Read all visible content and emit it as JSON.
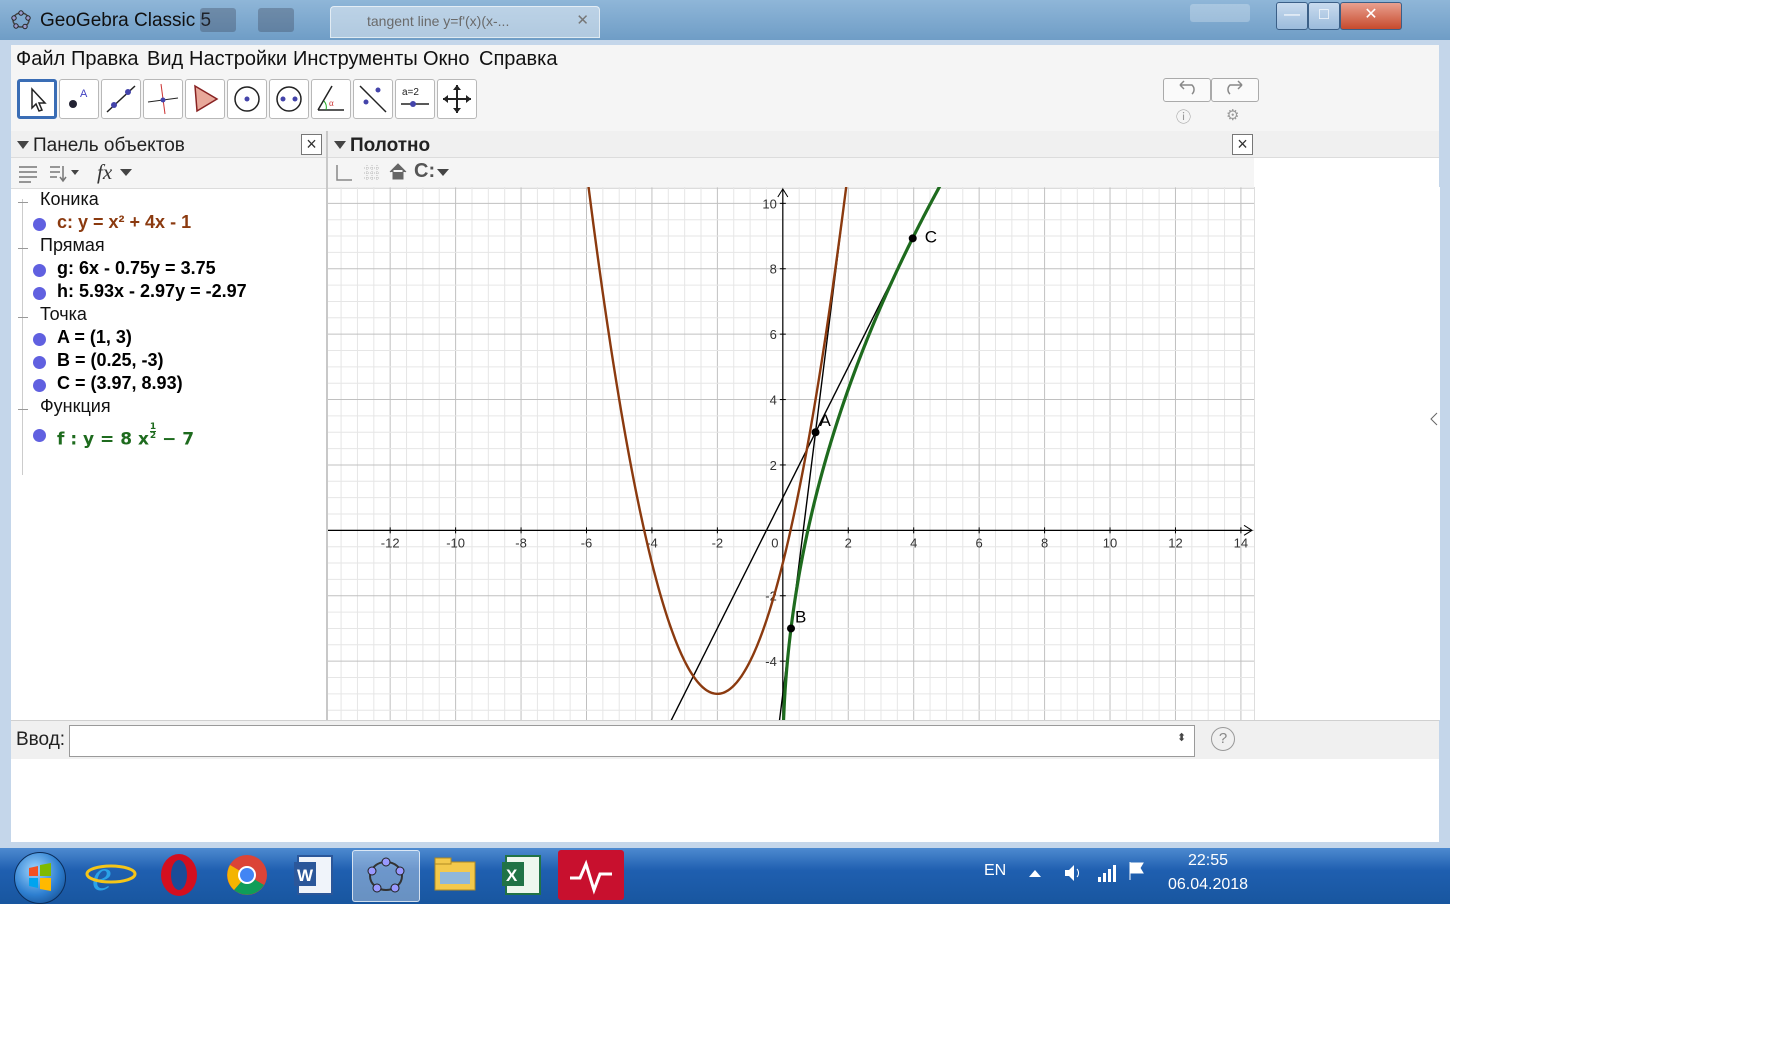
{
  "window": {
    "title": "GeoGebra Classic 5",
    "background_tab": "tangent line y=f'(x)(x-...",
    "buttons": {
      "minimize": "—",
      "maximize": "□",
      "close": "✕"
    }
  },
  "menu": [
    "Файл",
    "Правка",
    "Вид",
    "Настройки",
    "Инструменты",
    "Окно",
    "Справка"
  ],
  "toolbar": {
    "tools": [
      "move-tool",
      "point-tool",
      "line-tool",
      "perpendicular-tool",
      "polygon-tool",
      "circle-tool",
      "conic-tool",
      "angle-tool",
      "reflect-tool",
      "slider-tool",
      "move-view-tool"
    ],
    "slider_tool_label": "a=2",
    "undo_icon": "undo-icon",
    "redo_icon": "redo-icon"
  },
  "algebra": {
    "title": "Панель объектов",
    "categories": [
      {
        "name": "Коника",
        "items": [
          {
            "text": "c: y = x² + 4x - 1",
            "color": "#8B3A0F"
          }
        ]
      },
      {
        "name": "Прямая",
        "items": [
          {
            "text": "g: 6x - 0.75y = 3.75",
            "color": "#000000"
          },
          {
            "text": "h: 5.93x - 2.97y = -2.97",
            "color": "#000000"
          }
        ]
      },
      {
        "name": "Точка",
        "items": [
          {
            "text": "A = (1, 3)",
            "color": "#000000"
          },
          {
            "text": "B = (0.25, -3)",
            "color": "#000000"
          },
          {
            "text": "C = (3.97, 8.93)",
            "color": "#000000"
          }
        ]
      },
      {
        "name": "Функция",
        "items": [
          {
            "text_prefix": "f :  y = 8 x",
            "exponent_num": "1",
            "exponent_den": "2",
            "text_suffix": " − 7",
            "color": "#1E6B1E"
          }
        ]
      }
    ]
  },
  "graphics": {
    "title": "Полотно",
    "plot": {
      "x_ticks": [
        "-12",
        "-10",
        "-8",
        "-6",
        "-4",
        "-2",
        "0",
        "2",
        "4",
        "6",
        "8",
        "10",
        "12",
        "14"
      ],
      "y_ticks": [
        "10",
        "8",
        "6",
        "4",
        "2",
        "-2",
        "-4"
      ],
      "xlim": [
        -13.9,
        14.4
      ],
      "ylim": [
        -5.8,
        10.5
      ],
      "grid": true,
      "curves": {
        "parabola": {
          "expr": "x^2 + 4x - 1",
          "color": "#8B3A0F"
        },
        "function_f": {
          "expr": "8*sqrt(x) - 7",
          "color": "#1E6B1E"
        },
        "line_g": {
          "expr": "(6x - 3.75)/0.75",
          "color": "#000000"
        },
        "line_h": {
          "expr": "(5.93x + 2.97)/2.97",
          "color": "#000000"
        }
      },
      "points": [
        {
          "label": "A",
          "x": 1,
          "y": 3
        },
        {
          "label": "B",
          "x": 0.25,
          "y": -3
        },
        {
          "label": "C",
          "x": 3.97,
          "y": 8.93
        }
      ]
    }
  },
  "input": {
    "label": "Ввод:",
    "value": "",
    "help": "?"
  },
  "taskbar": {
    "apps": [
      "internet-explorer-icon",
      "opera-icon",
      "chrome-icon",
      "word-icon",
      "geogebra-icon",
      "file-explorer-icon",
      "excel-icon",
      "smart-notebook-icon"
    ],
    "language": "EN",
    "time": "22:55",
    "date": "06.04.2018"
  }
}
